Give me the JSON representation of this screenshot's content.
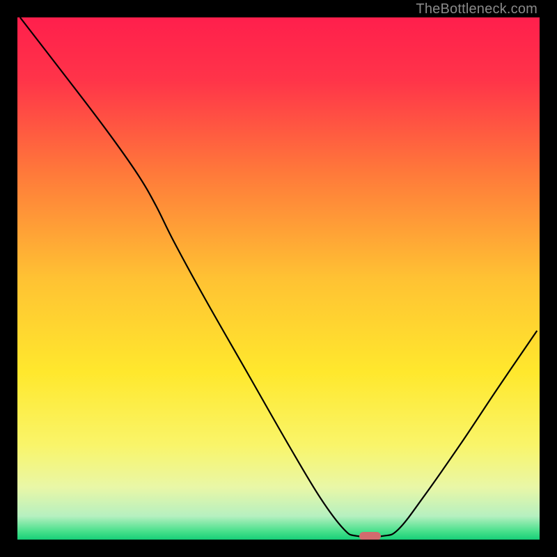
{
  "watermark": "TheBottleneck.com",
  "chart_data": {
    "type": "line",
    "title": "",
    "xlabel": "",
    "ylabel": "",
    "xlim": [
      0,
      100
    ],
    "ylim": [
      0,
      100
    ],
    "grid": false,
    "legend": false,
    "background_gradient": [
      {
        "pos": 0.0,
        "color": "#ff1f4c"
      },
      {
        "pos": 0.12,
        "color": "#ff3449"
      },
      {
        "pos": 0.3,
        "color": "#ff7a3a"
      },
      {
        "pos": 0.5,
        "color": "#ffc233"
      },
      {
        "pos": 0.68,
        "color": "#ffe82d"
      },
      {
        "pos": 0.82,
        "color": "#f9f56a"
      },
      {
        "pos": 0.9,
        "color": "#e9f7a7"
      },
      {
        "pos": 0.955,
        "color": "#b6f0c0"
      },
      {
        "pos": 0.985,
        "color": "#45e08a"
      },
      {
        "pos": 1.0,
        "color": "#17cf78"
      }
    ],
    "series": [
      {
        "name": "bottleneck-curve",
        "stroke": "#000000",
        "stroke_width": 2,
        "points": [
          {
            "x": 0.5,
            "y": 100.0
          },
          {
            "x": 9.0,
            "y": 89.0
          },
          {
            "x": 17.0,
            "y": 78.5
          },
          {
            "x": 23.0,
            "y": 70.0
          },
          {
            "x": 26.5,
            "y": 64.0
          },
          {
            "x": 30.0,
            "y": 57.0
          },
          {
            "x": 36.0,
            "y": 46.0
          },
          {
            "x": 44.0,
            "y": 32.0
          },
          {
            "x": 52.0,
            "y": 18.0
          },
          {
            "x": 58.0,
            "y": 8.0
          },
          {
            "x": 62.5,
            "y": 2.0
          },
          {
            "x": 65.0,
            "y": 0.7
          },
          {
            "x": 70.0,
            "y": 0.7
          },
          {
            "x": 73.0,
            "y": 2.0
          },
          {
            "x": 78.0,
            "y": 8.5
          },
          {
            "x": 85.0,
            "y": 18.5
          },
          {
            "x": 92.0,
            "y": 29.0
          },
          {
            "x": 99.5,
            "y": 40.0
          }
        ]
      }
    ],
    "marker": {
      "x": 67.5,
      "y": 0.7,
      "width": 4.2,
      "height": 1.6,
      "color": "#d36b6e",
      "shape": "rounded-rect"
    }
  }
}
